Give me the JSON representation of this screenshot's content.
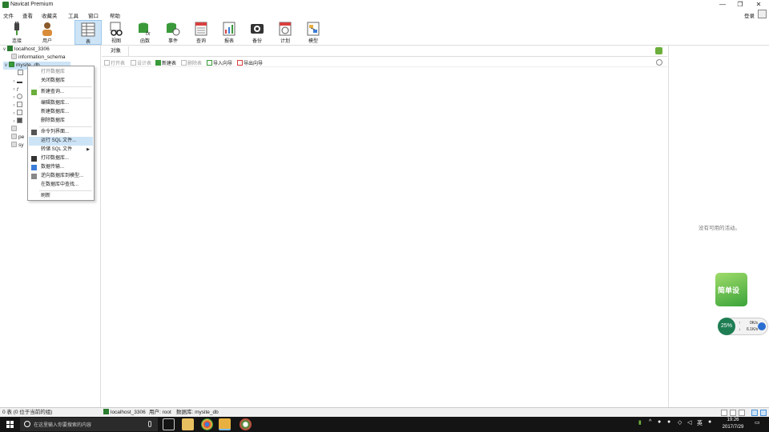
{
  "window": {
    "title": "Navicat Premium",
    "minimize": "—",
    "restore": "❐",
    "close": "✕"
  },
  "menu": {
    "items": [
      "文件",
      "查看",
      "收藏夹",
      "工具",
      "窗口",
      "帮助"
    ],
    "login": "登录"
  },
  "toolbar": {
    "items": [
      {
        "label": "连接",
        "icon": "plug-icon"
      },
      {
        "label": "用户",
        "icon": "user-icon"
      },
      {
        "label": "表",
        "icon": "table-icon",
        "active": true
      },
      {
        "label": "视图",
        "icon": "view-glasses-icon"
      },
      {
        "label": "函数",
        "icon": "function-icon"
      },
      {
        "label": "事件",
        "icon": "event-icon"
      },
      {
        "label": "查询",
        "icon": "query-icon"
      },
      {
        "label": "报表",
        "icon": "report-icon"
      },
      {
        "label": "备份",
        "icon": "backup-icon"
      },
      {
        "label": "计划",
        "icon": "schedule-icon"
      },
      {
        "label": "模型",
        "icon": "model-icon"
      }
    ]
  },
  "tree": {
    "connection": "localhost_3306",
    "databases": [
      "information_schema",
      "mysite_db",
      "pe",
      "sy"
    ],
    "selected_db_partial": "mysite_db"
  },
  "context_menu": {
    "items": [
      {
        "label": "打开数据库",
        "disabled": true,
        "icon": ""
      },
      {
        "label": "关闭数据库",
        "disabled": false,
        "icon": ""
      },
      {
        "sep": true
      },
      {
        "label": "新建查询...",
        "disabled": false,
        "icon": "new-query-icon"
      },
      {
        "sep": true
      },
      {
        "label": "编辑数据库...",
        "disabled": false,
        "icon": ""
      },
      {
        "label": "新建数据库...",
        "disabled": false,
        "icon": ""
      },
      {
        "label": "删除数据库",
        "disabled": false,
        "icon": ""
      },
      {
        "sep": true
      },
      {
        "label": "命令列界面...",
        "disabled": false,
        "icon": "console-icon"
      },
      {
        "label": "运行 SQL 文件...",
        "disabled": false,
        "highlight": true,
        "icon": ""
      },
      {
        "label": "转储 SQL 文件",
        "disabled": false,
        "submenu": true,
        "icon": ""
      },
      {
        "label": "打印数据库...",
        "disabled": false,
        "icon": "print-icon"
      },
      {
        "label": "数据传输...",
        "disabled": false,
        "icon": "transfer-icon"
      },
      {
        "label": "逆向数据库到模型...",
        "disabled": false,
        "icon": "reverse-icon"
      },
      {
        "label": "在数据库中查找...",
        "disabled": false,
        "icon": ""
      },
      {
        "sep": true
      },
      {
        "label": "刷新",
        "disabled": false,
        "icon": ""
      }
    ]
  },
  "object_tab": {
    "label": "对象"
  },
  "object_toolbar": {
    "items": [
      {
        "label": "打开表",
        "disabled": true
      },
      {
        "label": "设计表",
        "disabled": true
      },
      {
        "label": "新建表",
        "disabled": false
      },
      {
        "label": "删除表",
        "disabled": true
      },
      {
        "label": "导入向导",
        "disabled": false
      },
      {
        "label": "导出向导",
        "disabled": false
      }
    ]
  },
  "info_panel": {
    "empty_text": "没有可用的活动。"
  },
  "widgets": {
    "leaf_label": "简单设",
    "speed_percent": "25%",
    "up_speed": "0K/s",
    "down_speed": "6.1K/s",
    "up_arrow": "↑",
    "down_arrow": "↓"
  },
  "statusbar": {
    "left": "0 表 (0 位于当前的组)",
    "connection": "localhost_3306",
    "user": "用户: root",
    "database": "数据库: mysite_db"
  },
  "taskbar": {
    "search_placeholder": "在这里输入你要搜索的内容",
    "ime": "英",
    "time": "19:26",
    "date": "2017/7/29"
  }
}
